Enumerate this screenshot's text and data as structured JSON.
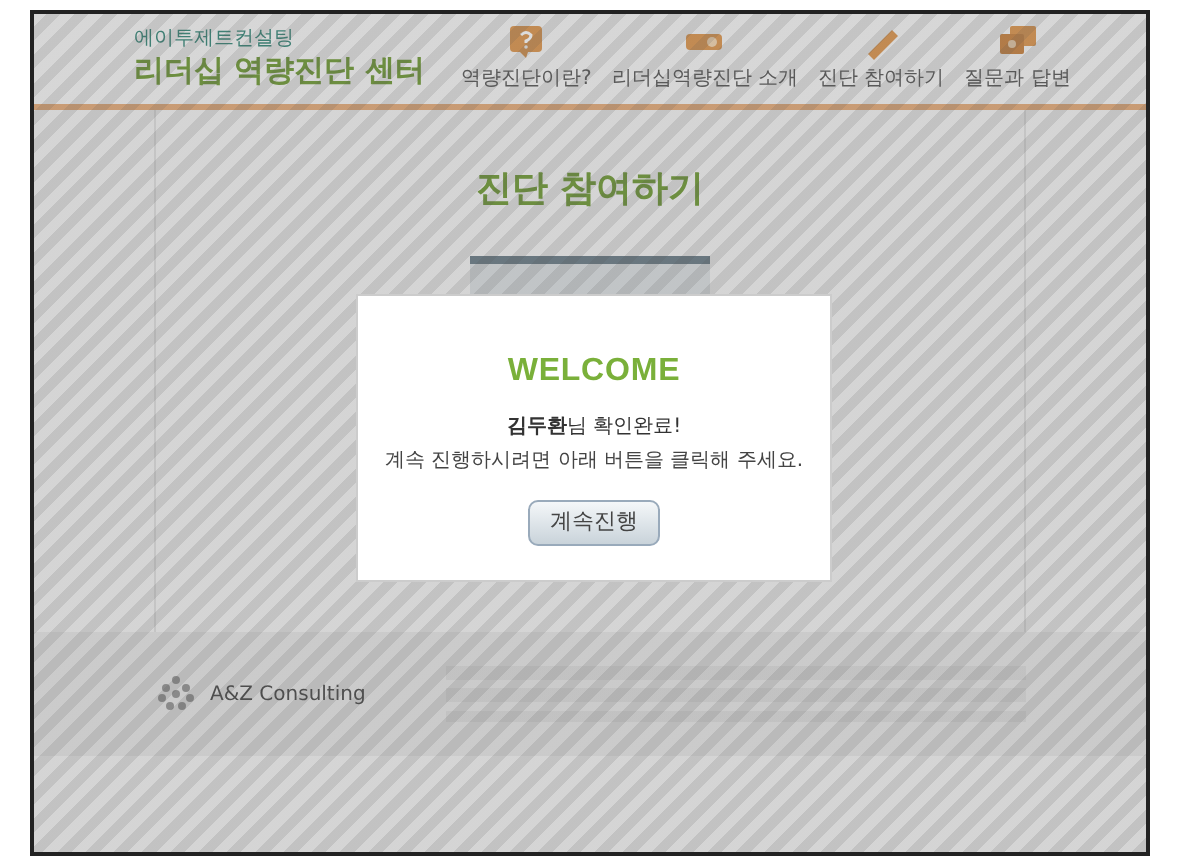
{
  "header": {
    "company": "에이투제트컨설팅",
    "title": "리더십 역량진단 센터",
    "nav": [
      {
        "label": "역량진단이란?",
        "kind": "question"
      },
      {
        "label": "리더십역량진단 소개",
        "kind": "toggle"
      },
      {
        "label": "진단 참여하기",
        "kind": "pencil"
      },
      {
        "label": "질문과 답변",
        "kind": "chat"
      }
    ]
  },
  "page": {
    "heading": "진단 참여하기"
  },
  "footer": {
    "logo": "A&Z Consulting"
  },
  "dialog": {
    "title": "WELCOME",
    "greeting": "**김두환**님 확인완료!",
    "message": "계속 진행하시려면 아래 버튼을 클릭해 주세요.",
    "button": "계속진행"
  }
}
